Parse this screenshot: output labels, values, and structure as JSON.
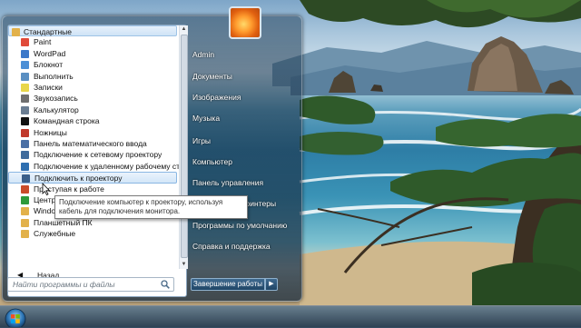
{
  "programs": {
    "folder_header": "Стандартные",
    "items": [
      {
        "label": "Paint",
        "icon": "paint-icon",
        "color": "#e04a3a"
      },
      {
        "label": "WordPad",
        "icon": "wordpad-icon",
        "color": "#3b78c9"
      },
      {
        "label": "Блокнот",
        "icon": "notepad-icon",
        "color": "#4b8fd6"
      },
      {
        "label": "Выполнить",
        "icon": "run-icon",
        "color": "#5a8fc2"
      },
      {
        "label": "Записки",
        "icon": "sticky-notes-icon",
        "color": "#e8d64a"
      },
      {
        "label": "Звукозапись",
        "icon": "microphone-icon",
        "color": "#6f6f6f"
      },
      {
        "label": "Калькулятор",
        "icon": "calculator-icon",
        "color": "#6a7d92"
      },
      {
        "label": "Командная строка",
        "icon": "cmd-icon",
        "color": "#111111"
      },
      {
        "label": "Ножницы",
        "icon": "scissors-icon",
        "color": "#c0392b"
      },
      {
        "label": "Панель математического ввода",
        "icon": "math-input-icon",
        "color": "#4a6fa5"
      },
      {
        "label": "Подключение к сетевому проектору",
        "icon": "network-projector-icon",
        "color": "#3f6b9c"
      },
      {
        "label": "Подключение к удаленному рабочему столу",
        "icon": "remote-desktop-icon",
        "color": "#2f6fb0"
      },
      {
        "label": "Подключить к проектору",
        "icon": "projector-icon",
        "color": "#3a5f8a"
      },
      {
        "label": "Приступая к работе",
        "icon": "getting-started-icon",
        "color": "#c94c2a"
      },
      {
        "label": "Центр синхронизации",
        "icon": "sync-center-icon",
        "color": "#2e9a3a"
      },
      {
        "label": "Windows PowerShell",
        "icon": "folder-icon",
        "color": "#e2b14a"
      },
      {
        "label": "Планшетный ПК",
        "icon": "folder-icon",
        "color": "#e2b14a"
      },
      {
        "label": "Служебные",
        "icon": "folder-icon",
        "color": "#e2b14a"
      }
    ],
    "highlighted_index": 12
  },
  "back_label": "Назад",
  "search": {
    "placeholder": "Найти программы и файлы"
  },
  "right_pane": {
    "items": [
      {
        "label": "Admin",
        "name": "user-admin"
      },
      {
        "label": "Документы",
        "name": "documents"
      },
      {
        "label": "Изображения",
        "name": "pictures"
      },
      {
        "label": "Музыка",
        "name": "music"
      },
      {
        "label": "Игры",
        "name": "games"
      },
      {
        "label": "Компьютер",
        "name": "computer"
      },
      {
        "label": "Панель управления",
        "name": "control-panel"
      },
      {
        "label": "Устройства и принтеры",
        "name": "devices-printers"
      },
      {
        "label": "Программы по умолчанию",
        "name": "default-programs"
      },
      {
        "label": "Справка и поддержка",
        "name": "help-support"
      }
    ],
    "shutdown_label": "Завершение работы"
  },
  "tooltip": "Подключение компьютер к проектору, используя кабель для подключения монитора."
}
